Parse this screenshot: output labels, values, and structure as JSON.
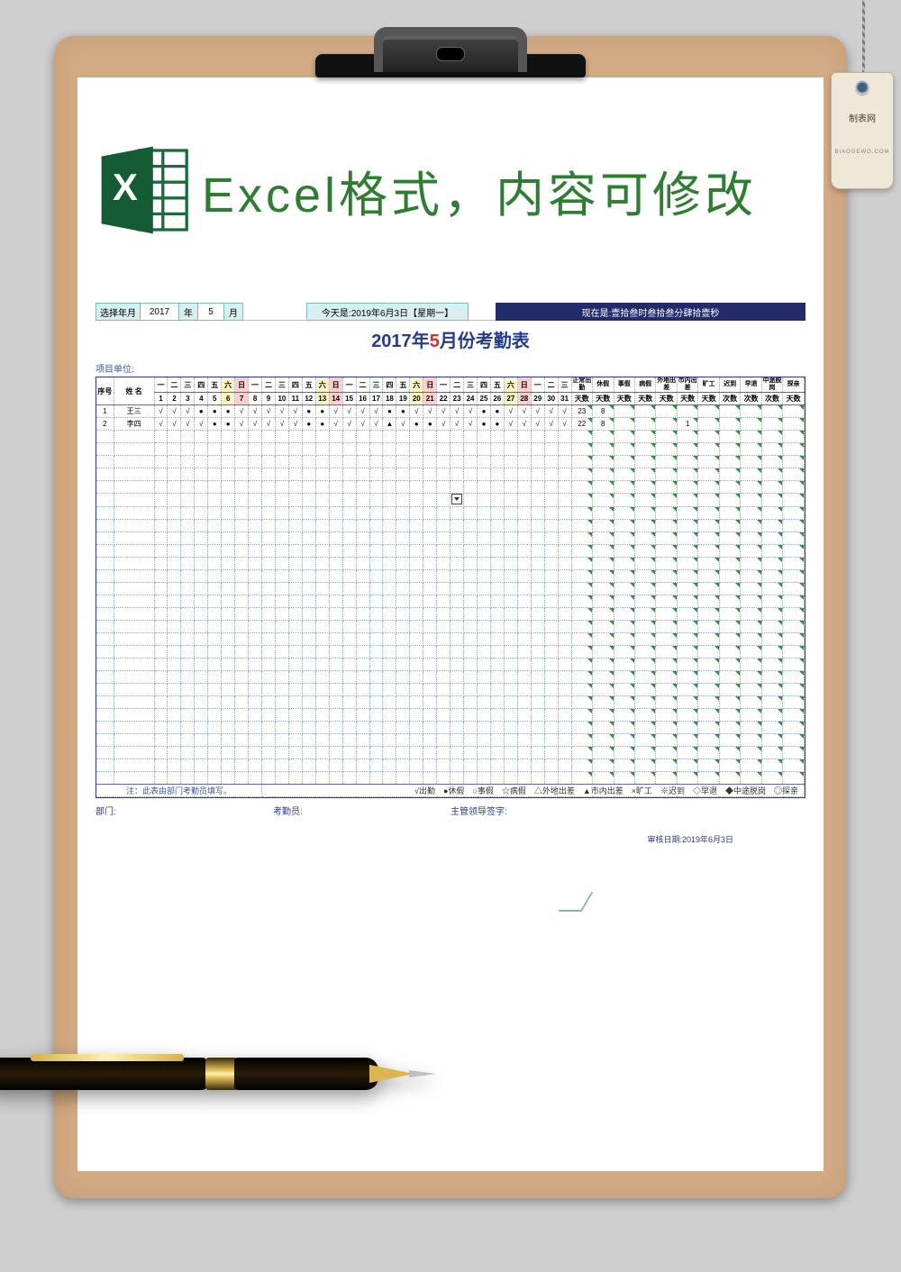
{
  "clipboard": {
    "tag_label": "制表网",
    "tag_sub": "BIAOGEWO.COM"
  },
  "header": {
    "banner": "Excel格式，内容可修改"
  },
  "selector": {
    "label": "选择年月",
    "year": "2017",
    "year_unit": "年",
    "month": "5",
    "month_unit": "月",
    "today": "今天是:2019年6月3日【星期一】",
    "now": "现在是:壹拾叁时叁拾叁分肆拾壹秒"
  },
  "title": {
    "pre": "2017",
    "mid": "年",
    "red": "5",
    "post": "月份考勤表"
  },
  "unit_label": "项目单位:",
  "columns": {
    "seq": "序号",
    "name": "姓 名",
    "weekday": [
      "一",
      "二",
      "三",
      "四",
      "五",
      "六",
      "日",
      "一",
      "二",
      "三",
      "四",
      "五",
      "六",
      "日",
      "一",
      "二",
      "三",
      "四",
      "五",
      "六",
      "日",
      "一",
      "二",
      "三",
      "四",
      "五",
      "六",
      "日",
      "一",
      "二",
      "三"
    ],
    "daynum": [
      "1",
      "2",
      "3",
      "4",
      "5",
      "6",
      "7",
      "8",
      "9",
      "10",
      "11",
      "12",
      "13",
      "14",
      "15",
      "16",
      "17",
      "18",
      "19",
      "20",
      "21",
      "22",
      "23",
      "24",
      "25",
      "26",
      "27",
      "28",
      "29",
      "30",
      "31"
    ],
    "stats_top": [
      "正常出勤",
      "休假",
      "事假",
      "病假",
      "外地出差",
      "市内出差",
      "旷工",
      "迟到",
      "早退",
      "中途脱岗",
      "探亲"
    ],
    "stats_bot": [
      "天数",
      "天数",
      "天数",
      "天数",
      "天数",
      "天数",
      "天数",
      "次数",
      "次数",
      "次数",
      "天数"
    ]
  },
  "rows": [
    {
      "seq": "1",
      "name": "王三",
      "marks": [
        "√",
        "√",
        "√",
        "●",
        "●",
        "●",
        "√",
        "√",
        "√",
        "√",
        "√",
        "●",
        "●",
        "√",
        "√",
        "√",
        "√",
        "●",
        "●",
        "√",
        "√",
        "√",
        "√",
        "√",
        "●",
        "●",
        "√",
        "√",
        "√",
        "√",
        "√"
      ],
      "stats": [
        "23",
        "8",
        "",
        "",
        "",
        "",
        "",
        "",
        "",
        "",
        ""
      ]
    },
    {
      "seq": "2",
      "name": "李四",
      "marks": [
        "√",
        "√",
        "√",
        "√",
        "●",
        "●",
        "√",
        "√",
        "√",
        "√",
        "√",
        "●",
        "●",
        "√",
        "√",
        "√",
        "√",
        "▲",
        "√",
        "●",
        "●",
        "√",
        "√",
        "√",
        "●",
        "●",
        "√",
        "√",
        "√",
        "√",
        "√"
      ],
      "stats": [
        "22",
        "8",
        "",
        "",
        "",
        "1",
        "",
        "",
        "",
        "",
        ""
      ]
    }
  ],
  "note": {
    "left": "注：此表由部门考勤员填写。",
    "legend": "√出勤　●休假　○事假　☆病假　△外地出差　▲市内出差　×旷工　※迟到　◇早退　◆中途脱岗　◎探亲"
  },
  "sign": {
    "dept": "部门:",
    "recorder": "考勤员:",
    "leader": "主管领导签字:",
    "audit": "审核日期:2019年6月3日"
  },
  "chart_data": null
}
